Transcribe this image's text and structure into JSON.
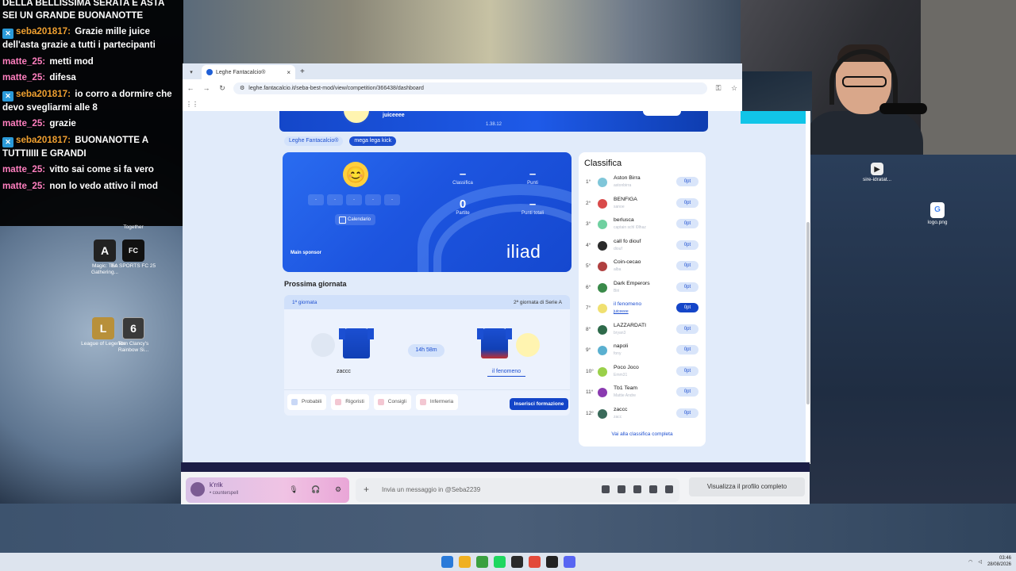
{
  "chat": {
    "lines": [
      {
        "user": "",
        "text": "DELLA BELLISSIMA SERATA E ASTA SEI UN GRANDE BUONANOTTE",
        "color": "#ffffff",
        "badge": false
      },
      {
        "user": "seba201817:",
        "text": "Grazie mille juice dell'asta grazie a tutti i partecipanti",
        "color": "#f0a030",
        "badge": true
      },
      {
        "user": "matte_25:",
        "text": "metti mod",
        "color": "#ff7fbf",
        "badge": false
      },
      {
        "user": "matte_25:",
        "text": "difesa",
        "color": "#ff7fbf",
        "badge": false
      },
      {
        "user": "seba201817:",
        "text": "io corro a dormire che devo svegliarmi alle 8",
        "color": "#f0a030",
        "badge": true
      },
      {
        "user": "matte_25:",
        "text": "grazie",
        "color": "#ff7fbf",
        "badge": false
      },
      {
        "user": "seba201817:",
        "text": "BUONANOTTE A TUTTIIIII E GRANDI",
        "color": "#f0a030",
        "badge": true
      },
      {
        "user": "matte_25:",
        "text": "vitto sai come si fa vero",
        "color": "#ff7fbf",
        "badge": false
      },
      {
        "user": "matte_25:",
        "text": "non lo vedo attivo il mod",
        "color": "#ff7fbf",
        "badge": false
      }
    ]
  },
  "desktop": {
    "icons": [
      {
        "label": "Together",
        "glyph": ""
      },
      {
        "label": "Magic: The Gathering...",
        "glyph": "A"
      },
      {
        "label": "EA SPORTS FC 25",
        "glyph": "FC"
      },
      {
        "label": "League of Legends",
        "glyph": "L"
      },
      {
        "label": "Tom Clancy's Rainbow Si...",
        "glyph": "6"
      },
      {
        "label": "sire-idratat...",
        "glyph": "▶"
      },
      {
        "label": "logo.png",
        "glyph": "G"
      }
    ]
  },
  "browser": {
    "tab_title": "Leghe Fantacalcio®",
    "url": "leghe.fantacalcio.it/seba-best-mod/view/competition/366438/dashboard"
  },
  "page": {
    "hero_name": "juiceeee",
    "hero_version": "1.38.12",
    "chips": [
      "Leghe Fantacalcio®",
      "mega lega kick"
    ],
    "team_card": {
      "emoji": "😊",
      "slots": [
        "-",
        "-",
        "-",
        "-",
        "-"
      ],
      "calendar_label": "Calendario",
      "stats": [
        {
          "value": "–",
          "label": "Classifica"
        },
        {
          "value": "–",
          "label": "Punti"
        },
        {
          "value": "0",
          "label": "Partite"
        },
        {
          "value": "–",
          "label": "Punti totali"
        }
      ],
      "sponsor_label": "Main sponsor",
      "sponsor_brand": "iliad"
    },
    "next_round": {
      "title": "Prossima giornata",
      "round": "1ª giornata",
      "serie_a": "2ª giornata di Serie A",
      "countdown": "14h 58m",
      "home": "zaccc",
      "away": "il fenomeno",
      "actions": [
        "Probabili",
        "Rigoristi",
        "Consigli",
        "Infermeria"
      ],
      "insert_label": "Inserisci formazione"
    },
    "standings": {
      "title": "Classifica",
      "rows": [
        {
          "pos": "1°",
          "name": "Aston Birra",
          "manager": "astonbirra",
          "pts": "0pt",
          "color": "#7fc6d9"
        },
        {
          "pos": "2°",
          "name": "BENFIGA",
          "manager": "sanoe",
          "pts": "0pt",
          "color": "#d94a4a"
        },
        {
          "pos": "3°",
          "name": "berlusca",
          "manager": "captain schl l0lhaz",
          "pts": "0pt",
          "color": "#6fd0a0"
        },
        {
          "pos": "4°",
          "name": "call fo diouf",
          "manager": "diouf",
          "pts": "0pt",
          "color": "#2a2a2a"
        },
        {
          "pos": "5°",
          "name": "Coin-cecao",
          "manager": "alba",
          "pts": "0pt",
          "color": "#b04040"
        },
        {
          "pos": "6°",
          "name": "Dark Emperors",
          "manager": "Biri",
          "pts": "0pt",
          "color": "#3a8a4a"
        },
        {
          "pos": "7°",
          "name": "il fenomeno",
          "manager": "juiceeee",
          "pts": "0pt",
          "color": "#f0e070"
        },
        {
          "pos": "8°",
          "name": "LAZZARDATI",
          "manager": "bryan3",
          "pts": "0pt",
          "color": "#2e6a4a"
        },
        {
          "pos": "9°",
          "name": "napoli",
          "manager": "fony",
          "pts": "0pt",
          "color": "#5ab0d0"
        },
        {
          "pos": "10°",
          "name": "Poco Joco",
          "manager": "Emm31",
          "pts": "0pt",
          "color": "#9ad04a"
        },
        {
          "pos": "11°",
          "name": "Tb1 Team",
          "manager": "Mattie Andre",
          "pts": "0pt",
          "color": "#8a3ab0"
        },
        {
          "pos": "12°",
          "name": "zaccc",
          "manager": "zacc",
          "pts": "0pt",
          "color": "#3a6a5a"
        }
      ],
      "view_all": "Vai alla classifica completa"
    }
  },
  "discord": {
    "username": "k'rrik",
    "status": "• counterspell",
    "input_placeholder": "Invia un messaggio in @Seba2239",
    "profile_button": "Visualizza il profilo completo"
  },
  "taskbar": {
    "time": "03:46",
    "date": "28/08/2026",
    "app_colors": [
      "#2a7ad9",
      "#f0b020",
      "#3aa040",
      "#1ed760",
      "#2a2a2a",
      "#e34a3a",
      "#222222",
      "#5865f2"
    ]
  }
}
